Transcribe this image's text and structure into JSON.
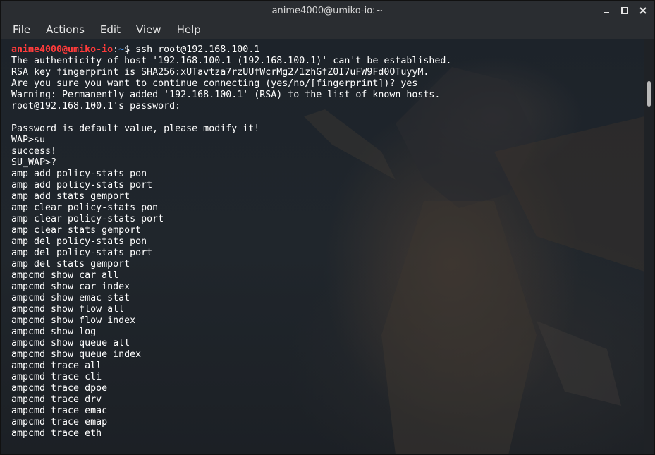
{
  "window": {
    "title": "anime4000@umiko-io:~",
    "controls": {
      "minimize": "minimize-icon",
      "maximize": "maximize-icon",
      "close": "close-icon"
    }
  },
  "menu": {
    "file": "File",
    "actions": "Actions",
    "edit": "Edit",
    "view": "View",
    "help": "Help"
  },
  "prompt": {
    "user_host": "anime4000@umiko-io",
    "colon": ":",
    "path": "~",
    "command": "$ ssh root@192.168.100.1"
  },
  "output": [
    "The authenticity of host '192.168.100.1 (192.168.100.1)' can't be established.",
    "RSA key fingerprint is SHA256:xUTavtza7rzUUfWcrMg2/1zhGfZ0I7uFW9Fd0OTuyyM.",
    "Are you sure you want to continue connecting (yes/no/[fingerprint])? yes",
    "Warning: Permanently added '192.168.100.1' (RSA) to the list of known hosts.",
    "root@192.168.100.1's password:",
    "",
    "Password is default value, please modify it!",
    "WAP>su",
    "success!",
    "SU_WAP>?",
    "amp add policy-stats pon",
    "amp add policy-stats port",
    "amp add stats gemport",
    "amp clear policy-stats pon",
    "amp clear policy-stats port",
    "amp clear stats gemport",
    "amp del policy-stats pon",
    "amp del policy-stats port",
    "amp del stats gemport",
    "ampcmd show car all",
    "ampcmd show car index",
    "ampcmd show emac stat",
    "ampcmd show flow all",
    "ampcmd show flow index",
    "ampcmd show log",
    "ampcmd show queue all",
    "ampcmd show queue index",
    "ampcmd trace all",
    "ampcmd trace cli",
    "ampcmd trace dpoe",
    "ampcmd trace drv",
    "ampcmd trace emac",
    "ampcmd trace emap",
    "ampcmd trace eth"
  ],
  "colors": {
    "user": "#ff3b3b",
    "path": "#4ea3ff",
    "text": "#ffffff",
    "chrome": "#2a2d31"
  }
}
